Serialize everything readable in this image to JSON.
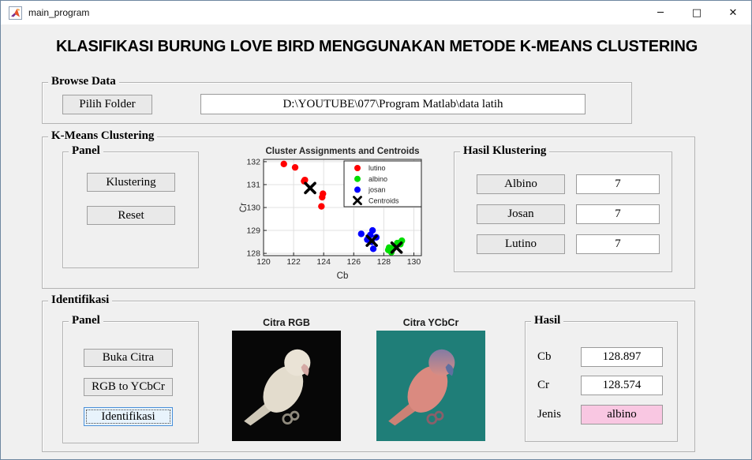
{
  "window": {
    "title": "main_program",
    "controls": {
      "minimize": "─",
      "maximize": "□",
      "close": "✕"
    }
  },
  "app_title": "KLASIFIKASI BURUNG LOVE BIRD MENGGUNAKAN METODE K-MEANS CLUSTERING",
  "browse_data": {
    "title": "Browse Data",
    "pilih_folder_label": "Pilih Folder",
    "path_value": "D:\\YOUTUBE\\077\\Program Matlab\\data latih"
  },
  "kmeans": {
    "title": "K-Means Clustering",
    "panel": {
      "title": "Panel",
      "klustering_label": "Klustering",
      "reset_label": "Reset"
    },
    "hasil": {
      "title": "Hasil Klustering",
      "rows": [
        {
          "label": "Albino",
          "value": "7"
        },
        {
          "label": "Josan",
          "value": "7"
        },
        {
          "label": "Lutino",
          "value": "7"
        }
      ]
    }
  },
  "identifikasi": {
    "title": "Identifikasi",
    "panel": {
      "title": "Panel",
      "buttons": [
        "Buka Citra",
        "RGB to YCbCr",
        "Identifikasi"
      ]
    },
    "citra_rgb_title": "Citra RGB",
    "citra_ycbcr_title": "Citra YCbCr",
    "hasil": {
      "title": "Hasil",
      "cb_label": "Cb",
      "cb_value": "128.897",
      "cr_label": "Cr",
      "cr_value": "128.574",
      "jenis_label": "Jenis",
      "jenis_value": "albino"
    }
  },
  "colors": {
    "accent_focus": "#4a90d9",
    "jenis_bg": "#f9c7e2",
    "rgb_image_bg": "#070707",
    "ycbcr_image_bg": "#1f7e78"
  },
  "chart_data": {
    "type": "scatter",
    "title": "Cluster Assignments and Centroids",
    "xlabel": "Cb",
    "ylabel": "Cr",
    "xlim": [
      120,
      130.5
    ],
    "ylim": [
      127.9,
      132.1
    ],
    "xticks": [
      120,
      122,
      124,
      126,
      128,
      130
    ],
    "yticks": [
      128,
      129,
      130,
      131,
      132
    ],
    "grid": true,
    "legend_position": "top-right",
    "series": [
      {
        "name": "lutino",
        "color": "#ff0000",
        "marker": "circle",
        "points": [
          [
            121.35,
            131.9
          ],
          [
            122.1,
            131.75
          ],
          [
            122.7,
            131.15
          ],
          [
            122.75,
            131.2
          ],
          [
            123.95,
            130.6
          ],
          [
            123.9,
            130.45
          ],
          [
            123.85,
            130.05
          ]
        ]
      },
      {
        "name": "albino",
        "color": "#00dd00",
        "marker": "circle",
        "points": [
          [
            128.35,
            128.25
          ],
          [
            129.1,
            128.4
          ],
          [
            129.2,
            128.55
          ],
          [
            128.5,
            128.05
          ],
          [
            128.3,
            128.15
          ],
          [
            128.7,
            128.3
          ],
          [
            128.9,
            128.45
          ]
        ]
      },
      {
        "name": "josan",
        "color": "#0000ff",
        "marker": "circle",
        "points": [
          [
            126.5,
            128.85
          ],
          [
            127.25,
            129.0
          ],
          [
            127.5,
            128.7
          ],
          [
            127.3,
            128.2
          ],
          [
            126.9,
            128.6
          ],
          [
            127.1,
            128.8
          ],
          [
            127.2,
            128.5
          ]
        ]
      },
      {
        "name": "Centroids",
        "color": "#000000",
        "marker": "x",
        "points": [
          [
            123.1,
            130.85
          ],
          [
            127.2,
            128.55
          ],
          [
            128.85,
            128.25
          ]
        ]
      }
    ]
  }
}
